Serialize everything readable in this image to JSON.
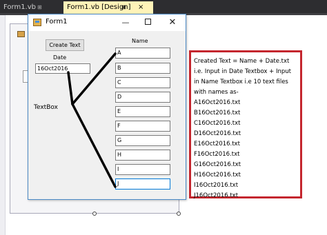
{
  "ide": {
    "tabs": [
      {
        "label": "Form1.vb",
        "active": false
      },
      {
        "label": "Form1.vb [Design]",
        "active": true
      }
    ],
    "pin_glyph": "⊞",
    "close_glyph": "×"
  },
  "form": {
    "title": "Form1",
    "buttons": {
      "minimize": "—",
      "close": "✕"
    },
    "create_button": "Create Text",
    "date_label": "Date",
    "date_value": "16Oct2016",
    "name_label": "Name",
    "textbox_label": "TextBox",
    "name_values": [
      "A",
      "B",
      "C",
      "D",
      "E",
      "F",
      "G",
      "H",
      "I",
      "J"
    ]
  },
  "annotation": {
    "lines": [
      "Created Text = Name + Date.txt",
      "i.e. Input in Date Textbox + Input",
      "in Name Textbox i.e 10 text files",
      "with names as-",
      "A16Oct2016.txt",
      "B16Oct2016.txt",
      "C16Oct2016.txt",
      "D16Oct2016.txt",
      "E16Oct2016.txt",
      "F16Oct2016.txt",
      "G16Oct2016.txt",
      "H16Oct2016.txt",
      "I16Oct2016.txt",
      "J16Oct2016.txt"
    ],
    "border_color": "#c4262e"
  },
  "colors": {
    "ide_tabstrip": "#2d2d30",
    "active_tab": "#fff3b8",
    "window_border": "#4a89c6"
  }
}
